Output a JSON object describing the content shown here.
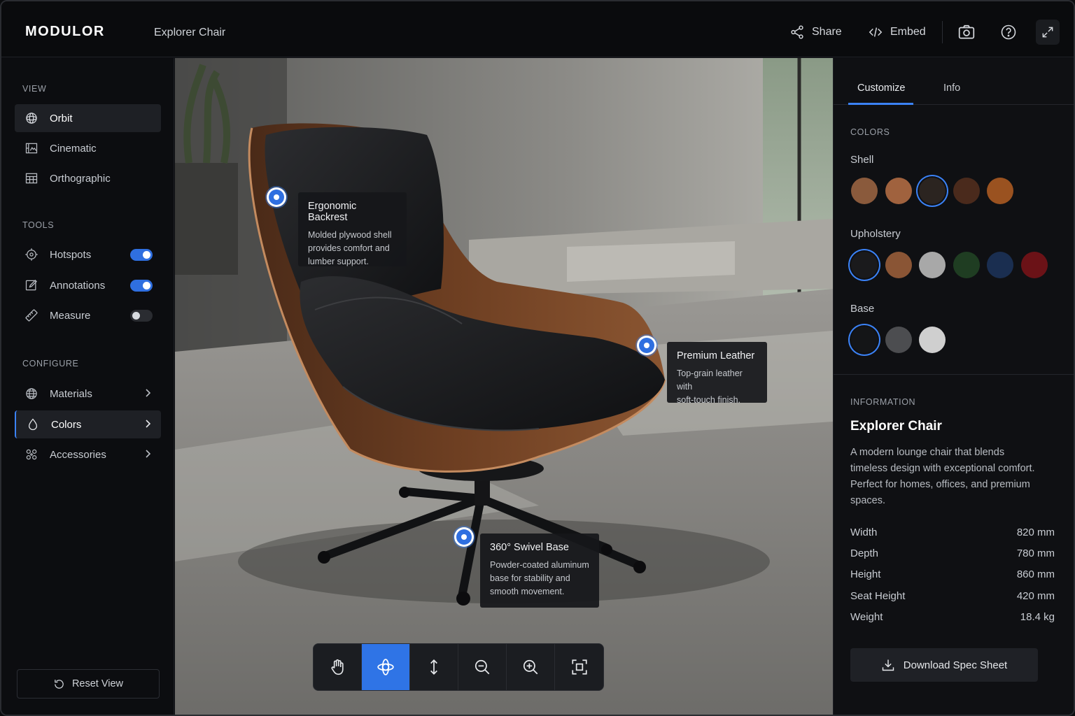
{
  "header": {
    "brand": "MODULOR",
    "title": "Explorer Chair",
    "share_label": "Share",
    "embed_label": "Embed",
    "icons": [
      "share-icon",
      "code-icon",
      "camera-icon",
      "help-icon",
      "expand-icon"
    ]
  },
  "sidebar": {
    "view_label": "VIEW",
    "view_items": [
      {
        "label": "Orbit",
        "icon": "orbit-icon",
        "active": true
      },
      {
        "label": "Cinematic",
        "icon": "film-icon"
      },
      {
        "label": "Orthographic",
        "icon": "grid-icon"
      }
    ],
    "tools_label": "TOOLS",
    "tool_items": [
      {
        "label": "Hotspots",
        "icon": "target-icon",
        "enabled": true
      },
      {
        "label": "Annotations",
        "icon": "annotation-icon",
        "enabled": true
      },
      {
        "label": "Measure",
        "icon": "ruler-icon",
        "enabled": false
      }
    ],
    "configure_label": "CONFIGURE",
    "configure_items": [
      {
        "label": "Materials",
        "icon": "globe-icon"
      },
      {
        "label": "Colors",
        "icon": "drop-icon",
        "active": true
      },
      {
        "label": "Accessories",
        "icon": "puzzle-icon"
      }
    ],
    "reset_label": "Reset View"
  },
  "viewport": {
    "hotspots": [
      {
        "title": "Ergonomic Backrest",
        "desc": [
          "Molded plywood shell",
          "provides comfort and",
          "lumber support."
        ]
      },
      {
        "title": "Premium Leather",
        "desc": [
          "Top-grain leather with",
          "soft-touch finish."
        ]
      },
      {
        "title": "360° Swivel Base",
        "desc": [
          "Powder-coated aluminum",
          "base for stability and",
          "smooth movement."
        ]
      }
    ],
    "toolbar": [
      "pan-hand-icon",
      "orbit-icon",
      "vertical-move-icon",
      "zoom-out-icon",
      "zoom-in-icon",
      "frame-fit-icon"
    ],
    "active_tool": "orbit-icon"
  },
  "panel": {
    "tabs": [
      "Customize",
      "Info"
    ],
    "active_tab": "Customize",
    "colors_label": "COLORS",
    "groups": [
      {
        "name": "Shell",
        "swatches": [
          "#8a5a3c",
          "#a0623e",
          "#2b2420",
          "#4a2a1c",
          "#9a5220"
        ],
        "selected": 2
      },
      {
        "name": "Upholstery",
        "swatches": [
          "#1a1a1c",
          "#8a5535",
          "#a8a8a8",
          "#1f3d22",
          "#1a2e50",
          "#6b1217"
        ],
        "selected": 0
      },
      {
        "name": "Base",
        "swatches": [
          "#141517",
          "#4c4d50",
          "#cfcfcf"
        ],
        "selected": 0
      }
    ],
    "information_label": "INFORMATION",
    "product_name": "Explorer Chair",
    "description": "A modern lounge chair that blends timeless design with exceptional comfort. Perfect for homes, offices, and premium spaces.",
    "specs": [
      {
        "label": "Width",
        "value": "820 mm"
      },
      {
        "label": "Depth",
        "value": "780 mm"
      },
      {
        "label": "Height",
        "value": "860 mm"
      },
      {
        "label": "Seat Height",
        "value": "420 mm"
      },
      {
        "label": "Weight",
        "value": "18.4 kg"
      }
    ],
    "download_label": "Download Spec Sheet"
  },
  "colors": {
    "accent": "#3b82f6",
    "background": "#0d0e11"
  }
}
